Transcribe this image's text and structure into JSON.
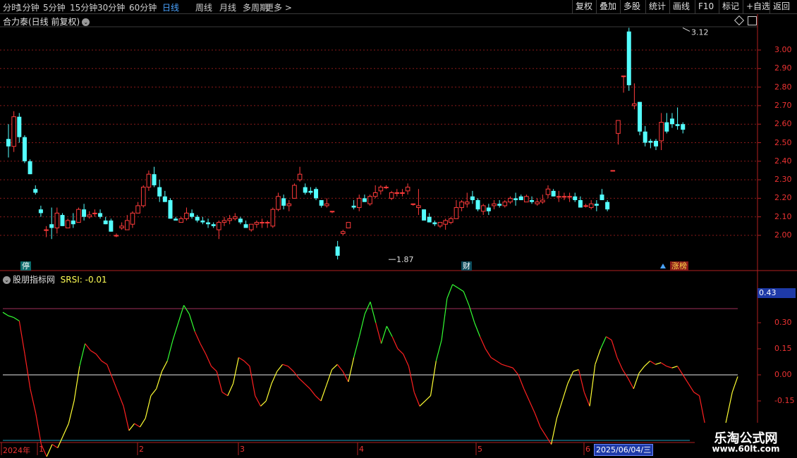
{
  "periods": [
    "分时",
    "1分钟",
    "5分钟",
    "15分钟",
    "30分钟",
    "60分钟",
    "日线",
    "周线",
    "月线",
    "多周期",
    "更多 >"
  ],
  "active_period": "日线",
  "right_buttons": [
    "复权",
    "叠加",
    "多股",
    "统计",
    "画线",
    "F10",
    "标记",
    "+自选",
    "返回"
  ],
  "main_title": "合力泰(日线 前复权)",
  "price_axis": [
    "3.00",
    "2.90",
    "2.80",
    "2.70",
    "2.60",
    "2.50",
    "2.40",
    "2.30",
    "2.20",
    "2.10",
    "2.00"
  ],
  "high_label": "3.12",
  "low_label": "1.87",
  "event_tags": {
    "stop": "停",
    "fin": "财",
    "limit": "涨榜"
  },
  "indicator": {
    "name": "股朋指标网",
    "label": "SRSI: -0.01",
    "axis": [
      "0.30",
      "0.15",
      "0.00",
      "-0.15"
    ],
    "current": "0.43"
  },
  "date_axis": [
    "2024年",
    "1",
    "2",
    "3",
    "4",
    "5",
    "6"
  ],
  "cursor_date": "2025/06/04/三",
  "watermark": {
    "cn": "乐淘公式网",
    "url": "www.60lt.com"
  },
  "colors": {
    "up": "#ff3b3b",
    "down": "#54ffff",
    "grid": "#8a1a1a",
    "srsi_up": "#ffff33",
    "srsi_green": "#33ff33",
    "srsi_down": "#ff2020"
  },
  "chart_data": {
    "type": "candlestick",
    "ylim": [
      1.87,
      3.12
    ],
    "candles": [
      [
        2.52,
        2.6,
        2.42,
        2.48
      ],
      [
        2.48,
        2.67,
        2.45,
        2.64
      ],
      [
        2.64,
        2.66,
        2.5,
        2.53
      ],
      [
        2.53,
        2.54,
        2.39,
        2.4
      ],
      [
        2.4,
        2.41,
        2.33,
        2.33
      ],
      [
        2.25,
        2.27,
        2.22,
        2.23
      ],
      [
        2.14,
        2.16,
        2.1,
        2.12
      ],
      [
        2.03,
        2.05,
        1.99,
        2.03
      ],
      [
        2.06,
        2.15,
        1.98,
        2.04
      ],
      [
        2.04,
        2.15,
        2.01,
        2.12
      ],
      [
        2.11,
        2.12,
        2.05,
        2.05
      ],
      [
        2.04,
        2.09,
        2.04,
        2.08
      ],
      [
        2.08,
        2.12,
        2.04,
        2.06
      ],
      [
        2.07,
        2.15,
        2.07,
        2.14
      ],
      [
        2.14,
        2.17,
        2.08,
        2.1
      ],
      [
        2.1,
        2.13,
        2.09,
        2.11
      ],
      [
        2.12,
        2.14,
        2.1,
        2.12
      ],
      [
        2.12,
        2.14,
        2.09,
        2.1
      ],
      [
        2.08,
        2.1,
        2.06,
        2.06
      ],
      [
        2.08,
        2.09,
        2.02,
        2.02
      ],
      [
        2.0,
        2.01,
        1.99,
        2.0
      ],
      [
        2.04,
        2.07,
        2.03,
        2.05
      ],
      [
        2.03,
        2.11,
        2.03,
        2.08
      ],
      [
        2.06,
        2.13,
        2.04,
        2.12
      ],
      [
        2.12,
        2.18,
        2.12,
        2.16
      ],
      [
        2.16,
        2.27,
        2.15,
        2.26
      ],
      [
        2.26,
        2.35,
        2.24,
        2.33
      ],
      [
        2.33,
        2.37,
        2.26,
        2.27
      ],
      [
        2.26,
        2.3,
        2.18,
        2.21
      ],
      [
        2.21,
        2.24,
        2.18,
        2.18
      ],
      [
        2.19,
        2.2,
        2.09,
        2.09
      ],
      [
        2.09,
        2.1,
        2.08,
        2.08
      ],
      [
        2.07,
        2.1,
        2.07,
        2.09
      ],
      [
        2.09,
        2.15,
        2.08,
        2.12
      ],
      [
        2.12,
        2.14,
        2.09,
        2.1
      ],
      [
        2.1,
        2.11,
        2.07,
        2.08
      ],
      [
        2.08,
        2.1,
        2.06,
        2.07
      ],
      [
        2.07,
        2.09,
        2.04,
        2.06
      ],
      [
        2.06,
        2.07,
        2.04,
        2.05
      ],
      [
        2.03,
        2.08,
        1.98,
        2.07
      ],
      [
        2.07,
        2.1,
        2.05,
        2.08
      ],
      [
        2.08,
        2.11,
        2.06,
        2.09
      ],
      [
        2.09,
        2.12,
        2.08,
        2.1
      ],
      [
        2.09,
        2.1,
        2.06,
        2.07
      ],
      [
        2.06,
        2.08,
        2.04,
        2.04
      ],
      [
        2.03,
        2.06,
        2.02,
        2.06
      ],
      [
        2.06,
        2.08,
        2.04,
        2.07
      ],
      [
        2.07,
        2.09,
        2.04,
        2.07
      ],
      [
        2.07,
        2.08,
        2.04,
        2.07
      ],
      [
        2.05,
        2.15,
        2.04,
        2.14
      ],
      [
        2.14,
        2.23,
        2.13,
        2.21
      ],
      [
        2.2,
        2.22,
        2.14,
        2.16
      ],
      [
        2.16,
        2.19,
        2.13,
        2.17
      ],
      [
        2.2,
        2.28,
        2.2,
        2.27
      ],
      [
        2.3,
        2.37,
        2.29,
        2.33
      ],
      [
        2.26,
        2.28,
        2.22,
        2.23
      ],
      [
        2.24,
        2.26,
        2.22,
        2.23
      ],
      [
        2.25,
        2.26,
        2.19,
        2.2
      ],
      [
        2.19,
        2.19,
        2.15,
        2.16
      ],
      [
        2.16,
        2.2,
        2.15,
        2.17
      ],
      [
        2.13,
        2.13,
        2.12,
        2.13
      ],
      [
        1.94,
        1.97,
        1.87,
        1.89
      ],
      [
        2.01,
        2.03,
        2.0,
        2.02
      ],
      [
        2.04,
        2.07,
        2.04,
        2.07
      ],
      [
        2.16,
        2.19,
        2.14,
        2.15
      ],
      [
        2.15,
        2.22,
        2.13,
        2.2
      ],
      [
        2.2,
        2.22,
        2.18,
        2.18
      ],
      [
        2.17,
        2.22,
        2.16,
        2.21
      ],
      [
        2.21,
        2.27,
        2.2,
        2.23
      ],
      [
        2.24,
        2.27,
        2.22,
        2.26
      ],
      [
        2.26,
        2.27,
        2.25,
        2.26
      ],
      [
        2.2,
        2.24,
        2.19,
        2.23
      ],
      [
        2.23,
        2.25,
        2.21,
        2.23
      ],
      [
        2.23,
        2.25,
        2.21,
        2.23
      ],
      [
        2.24,
        2.28,
        2.22,
        2.26
      ],
      [
        2.17,
        2.17,
        2.16,
        2.17
      ],
      [
        2.15,
        2.25,
        2.11,
        2.16
      ],
      [
        2.14,
        2.14,
        2.08,
        2.08
      ],
      [
        2.1,
        2.12,
        2.07,
        2.07
      ],
      [
        2.07,
        2.08,
        2.05,
        2.06
      ],
      [
        2.05,
        2.07,
        2.04,
        2.07
      ],
      [
        2.06,
        2.09,
        2.03,
        2.08
      ],
      [
        2.07,
        2.1,
        2.06,
        2.09
      ],
      [
        2.09,
        2.19,
        2.09,
        2.15
      ],
      [
        2.15,
        2.19,
        2.13,
        2.18
      ],
      [
        2.17,
        2.23,
        2.15,
        2.18
      ],
      [
        2.21,
        2.24,
        2.17,
        2.19
      ],
      [
        2.19,
        2.2,
        2.13,
        2.14
      ],
      [
        2.13,
        2.17,
        2.11,
        2.16
      ],
      [
        2.15,
        2.17,
        2.11,
        2.13
      ],
      [
        2.16,
        2.19,
        2.14,
        2.17
      ],
      [
        2.17,
        2.19,
        2.15,
        2.16
      ],
      [
        2.16,
        2.19,
        2.15,
        2.18
      ],
      [
        2.18,
        2.21,
        2.17,
        2.2
      ],
      [
        2.2,
        2.23,
        2.16,
        2.19
      ],
      [
        2.21,
        2.22,
        2.19,
        2.19
      ],
      [
        2.18,
        2.22,
        2.18,
        2.21
      ],
      [
        2.19,
        2.21,
        2.17,
        2.18
      ],
      [
        2.17,
        2.2,
        2.16,
        2.18
      ],
      [
        2.18,
        2.22,
        2.17,
        2.19
      ],
      [
        2.22,
        2.27,
        2.2,
        2.25
      ],
      [
        2.24,
        2.25,
        2.21,
        2.21
      ],
      [
        2.21,
        2.24,
        2.18,
        2.21
      ],
      [
        2.21,
        2.23,
        2.19,
        2.21
      ],
      [
        2.21,
        2.23,
        2.18,
        2.21
      ],
      [
        2.21,
        2.23,
        2.18,
        2.19
      ],
      [
        2.19,
        2.21,
        2.15,
        2.15
      ],
      [
        2.16,
        2.17,
        2.15,
        2.16
      ],
      [
        2.15,
        2.19,
        2.14,
        2.17
      ],
      [
        2.17,
        2.19,
        2.13,
        2.16
      ],
      [
        2.22,
        2.25,
        2.2,
        2.19
      ],
      [
        2.18,
        2.19,
        2.13,
        2.14
      ],
      [
        2.35,
        2.35,
        2.35,
        2.35
      ],
      [
        2.55,
        2.62,
        2.49,
        2.62
      ],
      [
        2.86,
        2.86,
        2.77,
        2.86
      ],
      [
        3.1,
        3.12,
        2.78,
        2.81
      ],
      [
        2.7,
        2.82,
        2.68,
        2.71
      ],
      [
        2.72,
        2.72,
        2.54,
        2.56
      ],
      [
        2.56,
        2.59,
        2.48,
        2.5
      ],
      [
        2.51,
        2.52,
        2.47,
        2.5
      ],
      [
        2.51,
        2.52,
        2.46,
        2.48
      ],
      [
        2.51,
        2.66,
        2.46,
        2.61
      ],
      [
        2.61,
        2.66,
        2.55,
        2.56
      ],
      [
        2.63,
        2.66,
        2.58,
        2.6
      ],
      [
        2.6,
        2.69,
        2.57,
        2.59
      ],
      [
        2.6,
        2.61,
        2.55,
        2.57
      ]
    ],
    "srsi": [
      0.36,
      0.34,
      0.33,
      0.31,
      0.12,
      -0.08,
      -0.22,
      -0.4,
      -0.47,
      -0.4,
      -0.42,
      -0.35,
      -0.28,
      -0.15,
      0.05,
      0.18,
      0.14,
      0.12,
      0.08,
      0.06,
      -0.02,
      -0.1,
      -0.18,
      -0.32,
      -0.28,
      -0.3,
      -0.25,
      -0.12,
      -0.08,
      0.02,
      0.08,
      0.2,
      0.3,
      0.4,
      0.35,
      0.25,
      0.18,
      0.12,
      0.05,
      0.02,
      -0.1,
      -0.12,
      -0.05,
      0.1,
      0.08,
      0.05,
      -0.12,
      -0.18,
      -0.15,
      -0.05,
      0.02,
      0.06,
      0.05,
      0.02,
      -0.02,
      -0.05,
      -0.08,
      -0.12,
      -0.15,
      -0.06,
      0.03,
      0.06,
      0.02,
      -0.04,
      0.1,
      0.22,
      0.35,
      0.42,
      0.3,
      0.18,
      0.28,
      0.22,
      0.15,
      0.12,
      0.05,
      -0.1,
      -0.18,
      -0.15,
      -0.12,
      0.08,
      0.2,
      0.44,
      0.52,
      0.5,
      0.48,
      0.4,
      0.3,
      0.22,
      0.15,
      0.1,
      0.08,
      0.06,
      0.05,
      0.04,
      0.0,
      -0.08,
      -0.15,
      -0.22,
      -0.3,
      -0.35,
      -0.4,
      -0.25,
      -0.15,
      -0.05,
      0.02,
      0.03,
      -0.1,
      -0.18,
      0.06,
      0.15,
      0.22,
      0.2,
      0.1,
      0.03,
      -0.02,
      -0.08,
      0.01,
      0.05,
      0.08,
      0.06,
      0.07,
      0.05,
      0.04,
      0.05,
      0.0,
      -0.05,
      -0.1,
      -0.12,
      -0.28,
      -0.35,
      -0.45,
      -0.4,
      -0.25,
      -0.1,
      -0.01
    ]
  }
}
